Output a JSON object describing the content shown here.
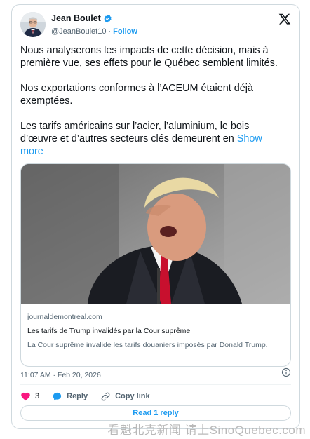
{
  "author": {
    "display_name": "Jean Boulet",
    "handle": "@JeanBoulet10",
    "separator": "·",
    "follow_label": "Follow"
  },
  "post": {
    "paragraph_1": "Nous analyserons les impacts de cette décision, mais à première vue, ses effets pour le Québec semblent limités.",
    "paragraph_2": "Nos exportations conformes à l’ACEUM étaient déjà exemptées.",
    "paragraph_3": "Les tarifs américains sur l’acier, l’aluminium, le bois d’œuvre et d’autres secteurs clés demeurent en",
    "show_more": "Show more"
  },
  "link_card": {
    "domain": "journaldemontreal.com",
    "title": "Les tarifs de Trump invalidés par la Cour suprême",
    "description": "La Cour suprême invalide les tarifs douaniers imposés par Donald Trump."
  },
  "meta": {
    "timestamp": "11:07 AM · Feb 20, 2026"
  },
  "actions": {
    "like_count": "3",
    "reply_label": "Reply",
    "copy_label": "Copy link"
  },
  "read_replies_label": "Read 1 reply",
  "watermark": "看魁北克新闻 请上SinoQuebec.com",
  "colors": {
    "accent": "#1d9bf0",
    "like": "#f91880",
    "text": "#0f1419",
    "muted": "#536471"
  }
}
